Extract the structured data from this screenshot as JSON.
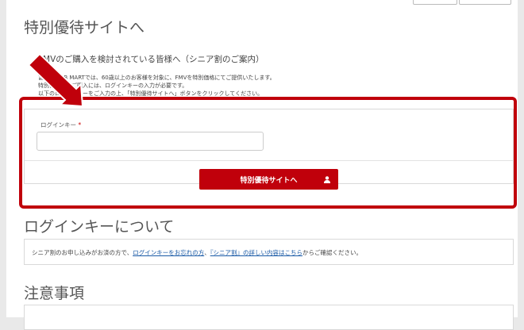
{
  "page_title": "特別優待サイトへ",
  "intro": {
    "lead": "FMVのご購入を検討されている皆様へ（シニア割のご案内）",
    "lines": [
      "富士通WEB MARTでは、60歳以上のお客様を対象に、FMVを特別価格にてご提供いたします。",
      "特別価格でのご購入には、ログインキーの入力が必要です。",
      "以下のログインキーをご入力の上、「特別優待サイトへ」ボタンをクリックしてください。"
    ]
  },
  "login": {
    "label": "ログインキー",
    "required_mark": "*",
    "input_value": "",
    "submit_label": "特別優待サイトへ",
    "submit_icon": "user-icon"
  },
  "about": {
    "heading": "ログインキーについて",
    "text_before": "シニア割のお申し込みがお済の方で、",
    "link1": "ログインキーをお忘れの方",
    "text_mid": "、",
    "link2": "『シニア割』の詳しい内容はこちら",
    "text_after": "からご確認ください。"
  },
  "notes": {
    "heading": "注意事項"
  },
  "colors": {
    "accent": "#c0000b",
    "link": "#1a5aa6"
  }
}
